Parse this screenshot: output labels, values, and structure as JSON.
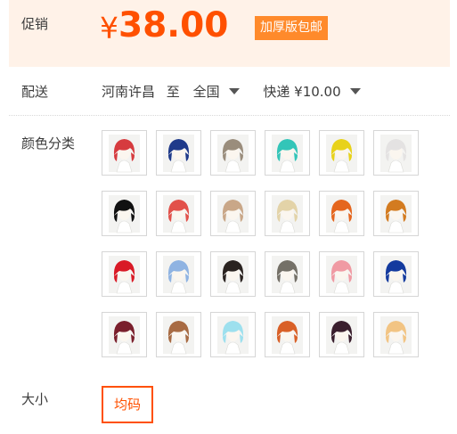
{
  "promotion": {
    "label": "促销",
    "currency": "¥",
    "price": "38.00",
    "badge": "加厚版包邮"
  },
  "delivery": {
    "label": "配送",
    "origin": "河南许昌",
    "to_word": "至",
    "destination": "全国",
    "shipping": "快递 ¥10.00"
  },
  "colors": {
    "label": "颜色分类",
    "swatches": [
      {
        "color": "#d63b3f"
      },
      {
        "color": "#1f3a8a"
      },
      {
        "color": "#9a8d7c"
      },
      {
        "color": "#33c5b8"
      },
      {
        "color": "#e8d21a"
      },
      {
        "color": "#e4e2e2"
      },
      {
        "color": "#111111"
      },
      {
        "color": "#e2514a"
      },
      {
        "color": "#c9a788"
      },
      {
        "color": "#e3d3a8"
      },
      {
        "color": "#e5661e"
      },
      {
        "color": "#d37b20"
      },
      {
        "color": "#d91a26"
      },
      {
        "color": "#8fb3e2"
      },
      {
        "color": "#2a2320"
      },
      {
        "color": "#747067"
      },
      {
        "color": "#f09aa3"
      },
      {
        "color": "#133a9e"
      },
      {
        "color": "#7a1f2c"
      },
      {
        "color": "#a86b43"
      },
      {
        "color": "#9de0ee"
      },
      {
        "color": "#d96027"
      },
      {
        "color": "#3a1f2e"
      },
      {
        "color": "#f2c483"
      }
    ]
  },
  "size": {
    "label": "大小",
    "options": [
      "均码"
    ]
  }
}
